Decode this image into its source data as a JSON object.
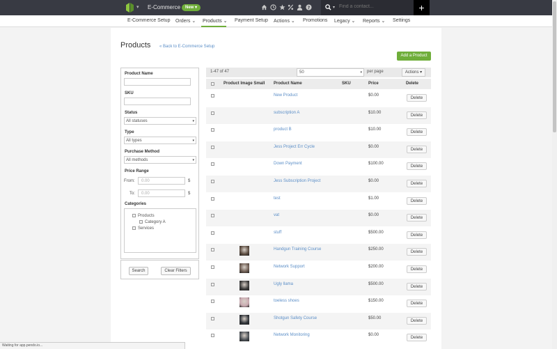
{
  "topbar": {
    "app_title": "E-Commerce",
    "new_label": "New",
    "new_caret": "▾",
    "logo_caret": "▾",
    "search_caret": "▾",
    "search_placeholder": "Find a contact...",
    "plus_label": "+"
  },
  "nav": {
    "items": [
      {
        "label": "E-Commerce Setup"
      },
      {
        "label": "Orders ⌄"
      },
      {
        "label": "Products ⌄"
      },
      {
        "label": "Payment Setup"
      },
      {
        "label": "Actions ⌄"
      },
      {
        "label": "Promotions"
      },
      {
        "label": "Legacy ⌄"
      },
      {
        "label": "Reports ⌄"
      },
      {
        "label": "Settings"
      }
    ],
    "active": "Products"
  },
  "page": {
    "title": "Products",
    "back_link": "« Back to E-Commerce Setup",
    "add_button": "Add a Product"
  },
  "filters": {
    "product_name_label": "Product Name",
    "sku_label": "SKU",
    "status_label": "Status",
    "status_value": "All statuses",
    "type_label": "Type",
    "type_value": "All types",
    "purchase_method_label": "Purchase Method",
    "purchase_method_value": "All methods",
    "price_range_label": "Price Range",
    "from_label": "From:",
    "to_label": "To:",
    "from_placeholder": "0.00",
    "to_placeholder": "0.00",
    "currency": "$",
    "select_caret": "▾",
    "categories_label": "Categories",
    "categories": [
      {
        "label": "Products"
      },
      {
        "label": "Category A"
      },
      {
        "label": "Services"
      }
    ],
    "search_button": "Search",
    "clear_button": "Clear Filters"
  },
  "table": {
    "count": "1-47 of 47",
    "per_page_value": "50",
    "per_page_label": "per page",
    "actions_label": "Actions ▾",
    "select_caret": "▾",
    "headers": {
      "image": "Product Image Small",
      "name": "Product Name",
      "sku": "SKU",
      "price": "Price",
      "delete": "Delete"
    },
    "delete_label": "Delete",
    "rows": [
      {
        "name": "New Product",
        "price": "$0.00",
        "thumb": false
      },
      {
        "name": "subscription A",
        "price": "$10.00",
        "thumb": false
      },
      {
        "name": "product B",
        "price": "$10.00",
        "thumb": false
      },
      {
        "name": "Jess Project Err Cycle",
        "price": "$0.00",
        "thumb": false
      },
      {
        "name": "Down Payment",
        "price": "$100.00",
        "thumb": false
      },
      {
        "name": "Jess Subscription Project",
        "price": "$0.00",
        "thumb": false
      },
      {
        "name": "test",
        "price": "$1.00",
        "thumb": false
      },
      {
        "name": "vat",
        "price": "$0.00",
        "thumb": false
      },
      {
        "name": "stuff",
        "price": "$500.00",
        "thumb": false
      },
      {
        "name": "Handgun Training Course",
        "price": "$250.00",
        "thumb": true,
        "thumb_color": "#5a4a3e"
      },
      {
        "name": "Network Support",
        "price": "$200.00",
        "thumb": true,
        "thumb_color": "#6b5a50"
      },
      {
        "name": "Ugly llama",
        "price": "$500.00",
        "thumb": true,
        "thumb_color": "#3a3a3a"
      },
      {
        "name": "toeless shoes",
        "price": "$150.00",
        "thumb": true,
        "thumb_color": "#c9a9b0"
      },
      {
        "name": "Shotgun Safety Course",
        "price": "$50.00",
        "thumb": true,
        "thumb_color": "#2e3238"
      },
      {
        "name": "Network Monitoring",
        "price": "$0.00",
        "thumb": true,
        "thumb_color": "#4a4f55"
      }
    ]
  },
  "status_bar": "Waiting for app.pendo.io...",
  "colors": {
    "accent_green": "#6fae3a",
    "link_blue": "#5b8ec7",
    "topbar_bg": "#383a43"
  }
}
